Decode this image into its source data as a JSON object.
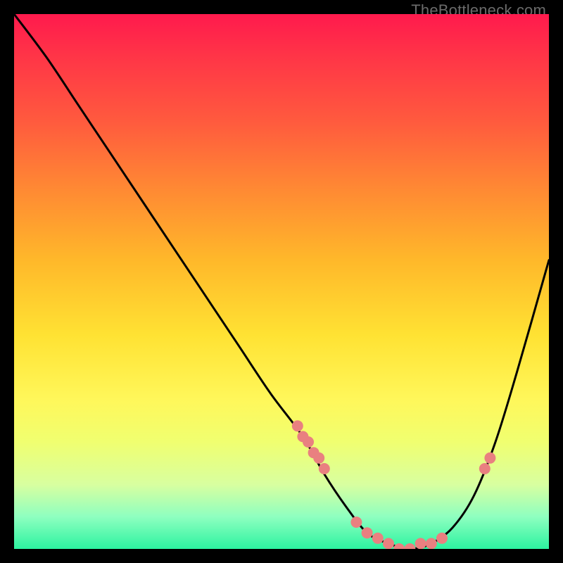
{
  "watermark": "TheBottleneck.com",
  "chart_data": {
    "type": "line",
    "title": "",
    "xlabel": "",
    "ylabel": "",
    "xlim": [
      0,
      100
    ],
    "ylim": [
      0,
      100
    ],
    "grid": false,
    "series": [
      {
        "name": "curve",
        "x": [
          0,
          6,
          12,
          18,
          24,
          30,
          36,
          42,
          48,
          54,
          58,
          62,
          66,
          70,
          74,
          78,
          82,
          86,
          90,
          94,
          100
        ],
        "values": [
          100,
          92,
          83,
          74,
          65,
          56,
          47,
          38,
          29,
          21,
          14,
          8,
          3,
          1,
          0,
          1,
          4,
          10,
          20,
          33,
          54
        ]
      }
    ],
    "highlight_points": {
      "name": "markers",
      "x": [
        53,
        54,
        55,
        56,
        57,
        58,
        64,
        66,
        68,
        70,
        72,
        74,
        76,
        78,
        80,
        88,
        89
      ],
      "values": [
        23,
        21,
        20,
        18,
        17,
        15,
        5,
        3,
        2,
        1,
        0,
        0,
        1,
        1,
        2,
        15,
        17
      ]
    },
    "background_gradient": {
      "direction": "top-to-bottom",
      "stops": [
        {
          "pos": 0,
          "color": "#ff1a4d"
        },
        {
          "pos": 20,
          "color": "#ff5a3e"
        },
        {
          "pos": 46,
          "color": "#ffb82a"
        },
        {
          "pos": 72,
          "color": "#fff75a"
        },
        {
          "pos": 94,
          "color": "#8effc0"
        },
        {
          "pos": 100,
          "color": "#2cf3a0"
        }
      ]
    }
  }
}
